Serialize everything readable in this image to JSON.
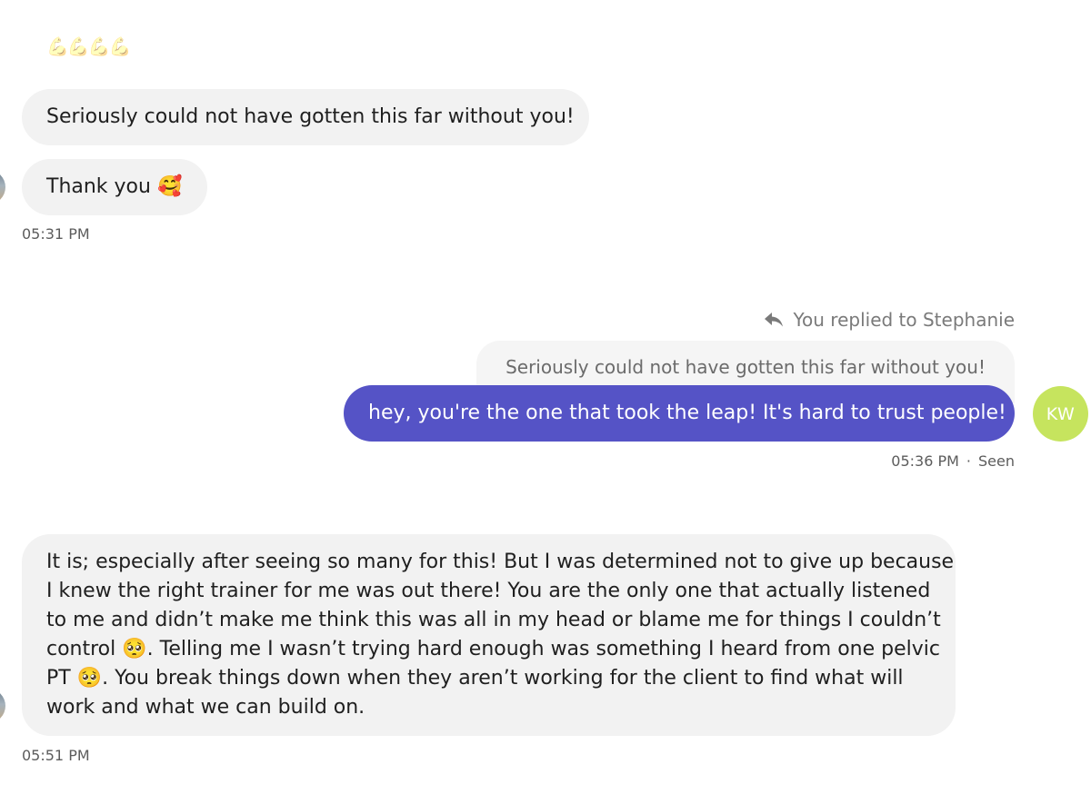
{
  "messages": {
    "muscle_emojis": "💪💪💪💪",
    "msg1": "Seriously could not have gotten this far without you!",
    "msg2": "Thank you 🥰",
    "time1": "05:31 PM",
    "reply_note": "You replied to Stephanie",
    "quoted": "Seriously could not have gotten this far without you!",
    "outgoing": "hey, you're the one that took the leap! It's hard to trust people!",
    "outgoing_time": "05:36 PM",
    "separator": "·",
    "seen": "Seen",
    "long_lines": [
      "It is; especially after seeing so many for this! But I was determined not to give up because",
      "I knew the right trainer for me was out there! You are the only one that actually listened",
      "to me and didn’t make me think this was all in my head or blame me for things I couldn’t",
      "control 🥺. Telling me I wasn’t trying hard enough was something I heard from one pelvic",
      "PT 🥺. You break things down when they aren’t working for the client to find what will",
      "work and what we can build on."
    ],
    "time3": "05:51 PM"
  },
  "avatars": {
    "me_initials": "KW",
    "me_color": "#c6e45e"
  },
  "colors": {
    "outgoing_bubble": "#5553c6",
    "incoming_bubble": "#f2f2f2"
  },
  "icons": {
    "reply": "reply-arrow-icon"
  }
}
